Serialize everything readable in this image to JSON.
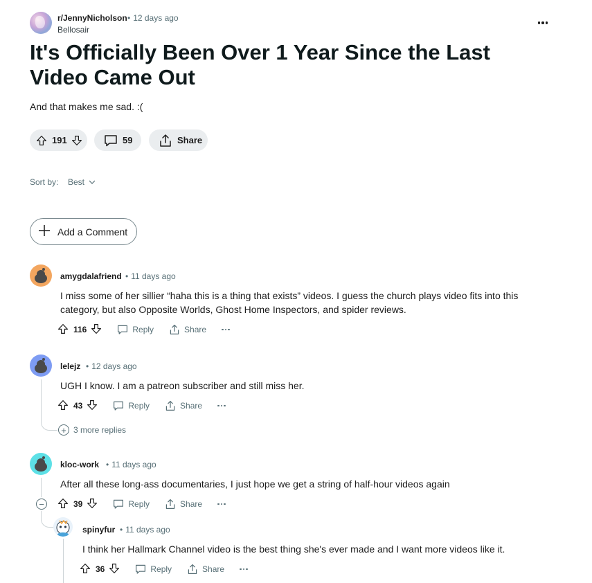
{
  "post": {
    "subreddit": "r/JennyNicholson",
    "age": "12 days ago",
    "author": "Bellosair",
    "title": "It's Officially Been Over 1 Year Since the Last Video Came Out",
    "body": "And that makes me sad. :(",
    "votes": "191",
    "comments": "59",
    "share_label": "Share"
  },
  "sort": {
    "label": "Sort by:",
    "value": "Best"
  },
  "add_comment_label": "Add a Comment",
  "comments": [
    {
      "user": "amygdalafriend",
      "age": "11 days ago",
      "text": "I miss some of her sillier “haha this is a thing that exists” videos. I guess the church plays video fits into this category, but also Opposite Worlds, Ghost Home Inspectors, and spider reviews.",
      "votes": "116",
      "reply_label": "Reply",
      "share_label": "Share",
      "avatar_color": "#f3a65f"
    },
    {
      "user": "lelejz",
      "age": "12 days ago",
      "text": "UGH I know. I am a patreon subscriber and still miss her.",
      "votes": "43",
      "reply_label": "Reply",
      "share_label": "Share",
      "more_replies": "3 more replies",
      "avatar_color": "#7e9cf3"
    },
    {
      "user": "kloc-work",
      "age": "11 days ago",
      "text": "After all these long-ass documentaries, I just hope we get a string of half-hour videos again",
      "votes": "39",
      "reply_label": "Reply",
      "share_label": "Share",
      "avatar_color": "#5de0e6"
    },
    {
      "user": "spinyfur",
      "age": "11 days ago",
      "text": "I think her Hallmark Channel video is the best thing she's ever made and I want more videos like it.",
      "votes": "36",
      "reply_label": "Reply",
      "share_label": "Share"
    }
  ]
}
